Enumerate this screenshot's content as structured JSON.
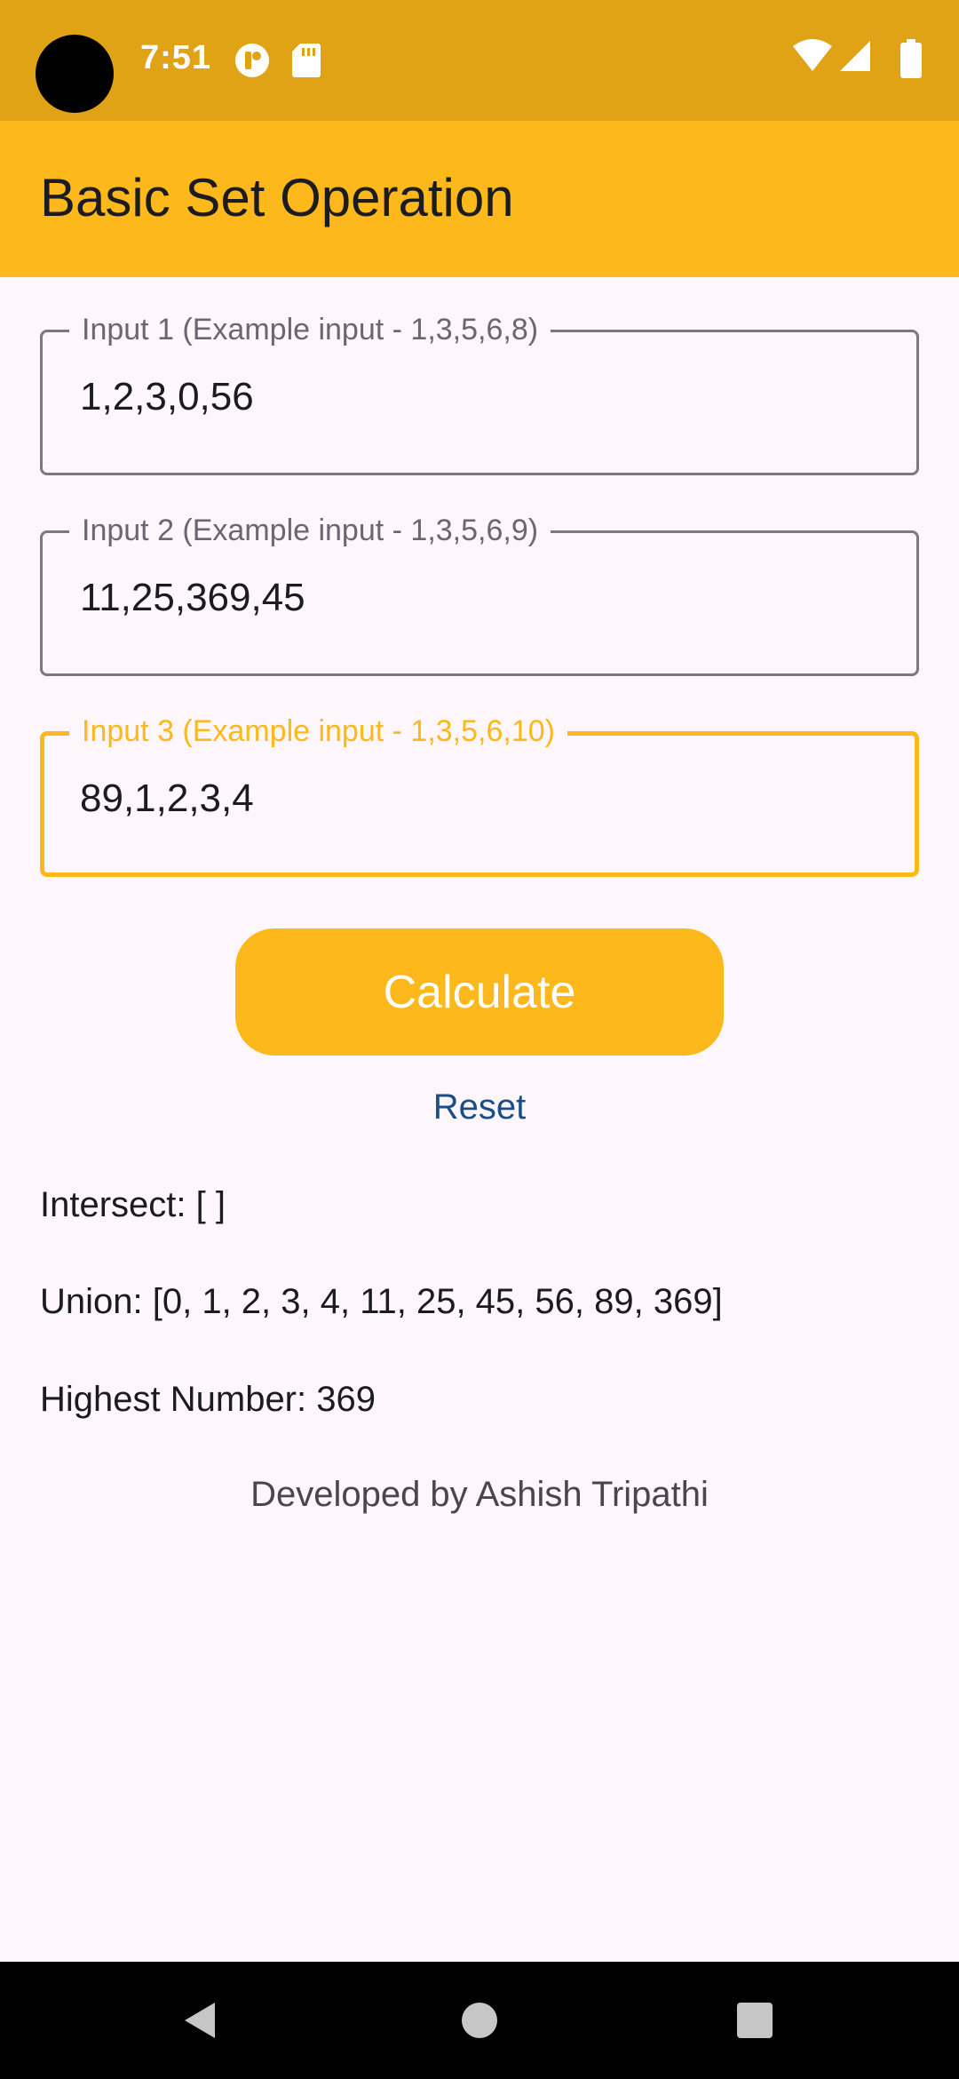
{
  "status_bar": {
    "time": "7:51",
    "notification_icons": [
      "app-notification-icon",
      "sd-card-icon"
    ],
    "system_icons": [
      "wifi-icon",
      "cell-signal-icon",
      "battery-icon"
    ]
  },
  "app_bar": {
    "title": "Basic Set Operation"
  },
  "inputs": [
    {
      "label": "Input 1 (Example input - 1,3,5,6,8)",
      "value": "1,2,3,0,56"
    },
    {
      "label": "Input 2 (Example input - 1,3,5,6,9)",
      "value": "11,25,369,45"
    },
    {
      "label": "Input 3 (Example input - 1,3,5,6,10)",
      "value": "89,1,2,3,4"
    }
  ],
  "actions": {
    "calculate_label": "Calculate",
    "reset_label": "Reset"
  },
  "results": {
    "intersect": "Intersect: [ ]",
    "union": "Union: [0, 1, 2, 3, 4, 11, 25, 45, 56, 89, 369]",
    "highest": "Highest Number: 369"
  },
  "footer": {
    "credit": "Developed by Ashish Tripathi"
  },
  "colors": {
    "accent": "#fdb81b",
    "status_bar": "#e0a316",
    "link": "#1b4e86",
    "background": "#fdf7fb"
  }
}
